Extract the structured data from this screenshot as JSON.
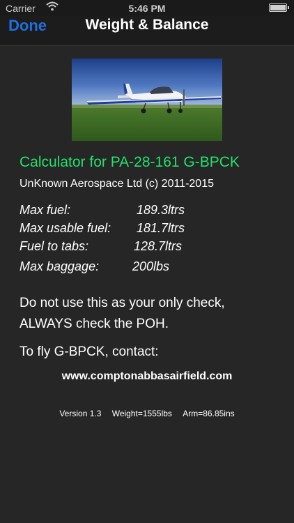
{
  "status_bar": {
    "carrier": "Carrier",
    "time": "5:46 PM"
  },
  "nav": {
    "done_label": "Done",
    "title": "Weight & Balance"
  },
  "calculator": {
    "heading": "Calculator for PA-28-161 G-BPCK",
    "copyright": "UnKnown Aerospace Ltd (c) 2011-2015"
  },
  "specs": [
    {
      "label": "Max fuel:",
      "value": "189.3ltrs"
    },
    {
      "label": "Max usable fuel:",
      "value": "181.7ltrs"
    },
    {
      "label": "Fuel to tabs:",
      "value": "128.7ltrs"
    },
    {
      "label": "Max baggage:",
      "value": "200lbs"
    }
  ],
  "warning": {
    "line1": "Do not use this as your only check,",
    "line2": "ALWAYS check the POH."
  },
  "contact": {
    "text": "To fly G-BPCK, contact:",
    "website": "www.comptonabbasairfield.com"
  },
  "footer": {
    "version": "Version 1.3",
    "weight": "Weight=1555lbs",
    "arm": "Arm=86.85ins"
  }
}
